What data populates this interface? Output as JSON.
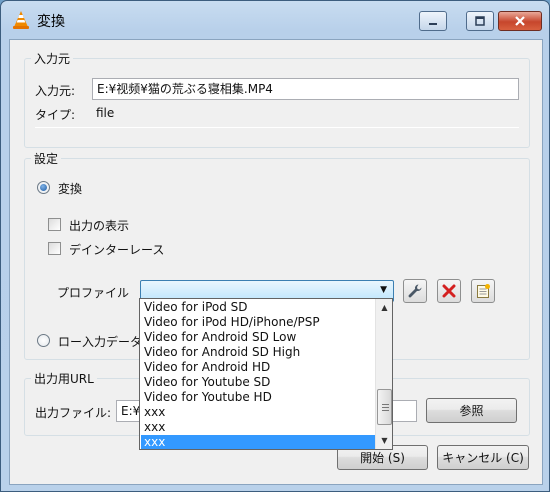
{
  "window": {
    "title": "変換",
    "minimize_label": "Minimize",
    "maximize_label": "Maximize",
    "close_label": "Close"
  },
  "source": {
    "group_label": "入力元",
    "input_label": "入力元:",
    "input_value": "E:¥视频¥猫の荒ぶる寝相集.MP4",
    "type_label": "タイプ:",
    "type_value": "file"
  },
  "settings": {
    "group_label": "設定",
    "convert_label": "変換",
    "display_output_label": "出力の表示",
    "deinterlace_label": "デインターレース",
    "profile_label": "プロファイル",
    "profile_selected": "",
    "raw_dump_label": "ロー入力データ"
  },
  "dropdown": {
    "items": [
      "Video for iPod SD",
      "Video for iPod HD/iPhone/PSP",
      "Video for Android SD Low",
      "Video for Android SD High",
      "Video for Android HD",
      "Video for Youtube SD",
      "Video for Youtube HD",
      "xxx",
      "xxx",
      "xxx"
    ],
    "selected_index": 9
  },
  "destination": {
    "group_label": "出力用URL",
    "file_label": "出力ファイル:",
    "file_value": "E:¥",
    "browse_label": "参照"
  },
  "footer": {
    "start_label": "開始 (S)",
    "cancel_label": "キャンセル (C)"
  },
  "colors": {
    "selection": "#3399ff",
    "delete_icon": "#d42020",
    "titlebar": "#b8d0ea"
  }
}
